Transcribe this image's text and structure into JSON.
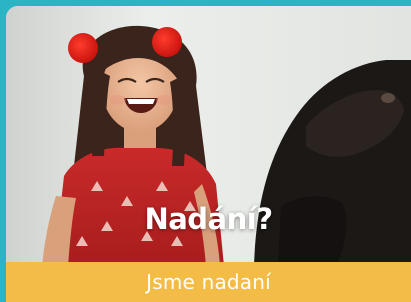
{
  "card": {
    "headline": "Nadání?",
    "cta_label": "Jsme nadaní"
  },
  "colors": {
    "page_background": "#2bb5c4",
    "cta_background": "#f2bc47",
    "text": "#ffffff"
  },
  "photo": {
    "subject_icons": [
      "girl-laughing-illustration",
      "black-dog-illustration"
    ]
  }
}
